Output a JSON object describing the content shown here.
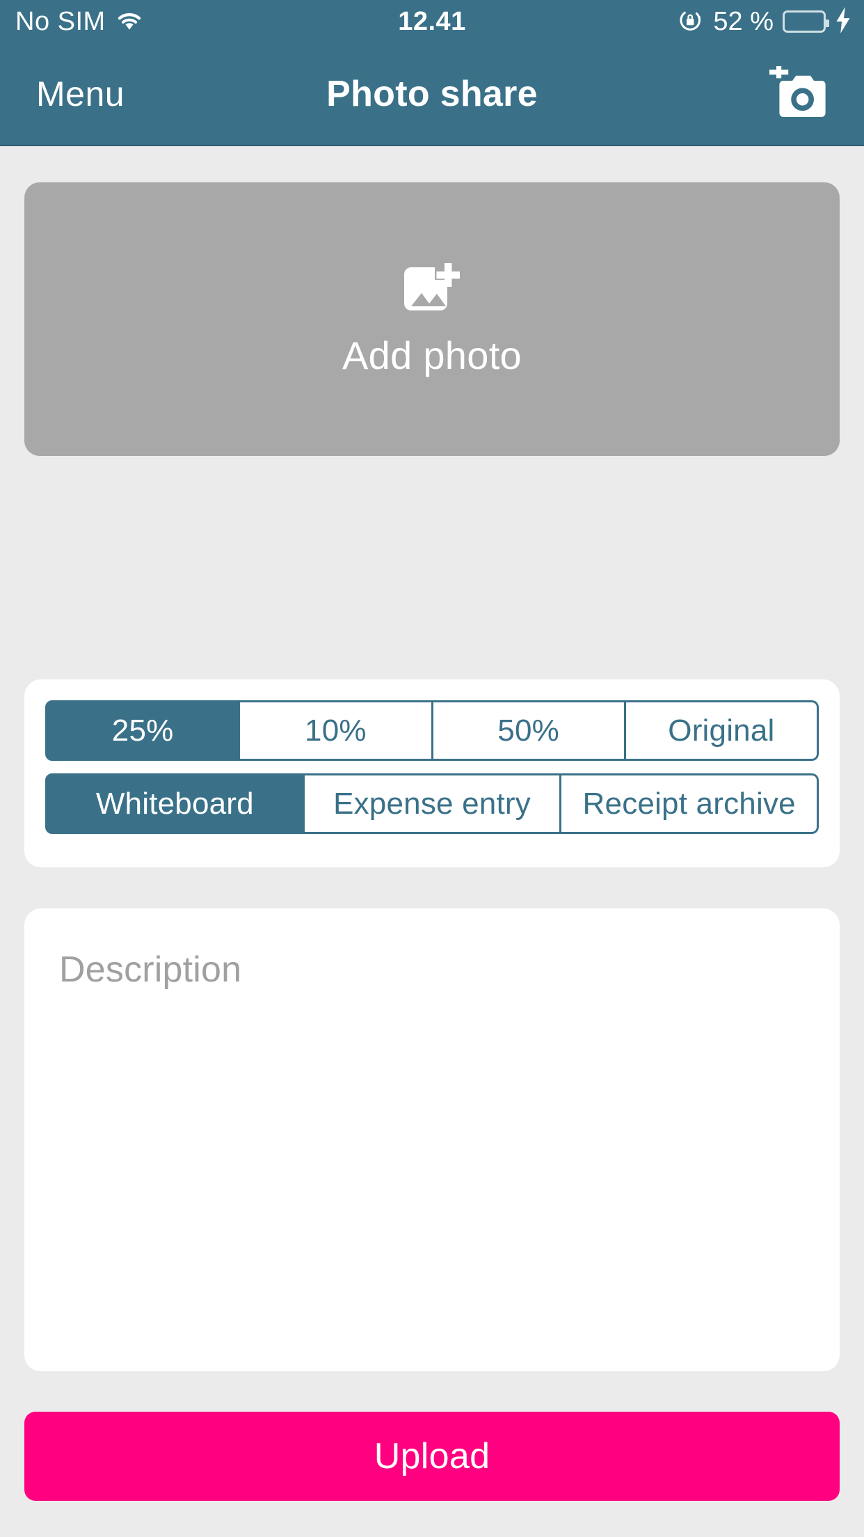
{
  "status_bar": {
    "carrier": "No SIM",
    "wifi_icon": "wifi-icon",
    "time": "12.41",
    "rotation_lock_icon": "rotation-lock-icon",
    "battery_percent_label": "52 %",
    "battery_level": 52,
    "charging_icon": "lightning-bolt-icon",
    "battery_fill_color": "#3BE04A",
    "background_color": "#3A7189"
  },
  "navbar": {
    "menu_label": "Menu",
    "title": "Photo share",
    "camera_icon": "add-photo-camera-icon",
    "background_color": "#3A7189"
  },
  "photo_area": {
    "icon": "add-image-icon",
    "label": "Add photo",
    "background_color": "#A8A8A8"
  },
  "quality_options": [
    {
      "label": "25%",
      "selected": true
    },
    {
      "label": "10%",
      "selected": false
    },
    {
      "label": "50%",
      "selected": false
    },
    {
      "label": "Original",
      "selected": false
    }
  ],
  "category_options": [
    {
      "label": "Whiteboard",
      "selected": true
    },
    {
      "label": "Expense entry",
      "selected": false
    },
    {
      "label": "Receipt archive",
      "selected": false
    }
  ],
  "description": {
    "value": "",
    "placeholder": "Description"
  },
  "upload": {
    "label": "Upload",
    "color": "#FF0080"
  },
  "theme": {
    "accent": "#3A7189",
    "page_background": "#EBEBEB",
    "card_background": "#FFFFFF"
  }
}
